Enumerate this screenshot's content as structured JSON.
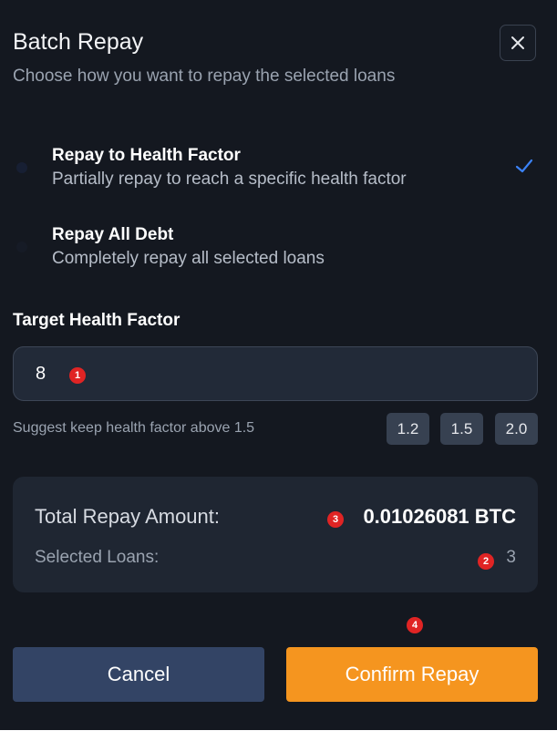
{
  "dialog": {
    "title": "Batch Repay",
    "subtitle": "Choose how you want to repay the selected loans",
    "close_icon": "close-icon"
  },
  "options": [
    {
      "title": "Repay to Health Factor",
      "description": "Partially repay to reach a specific health factor",
      "selected": true
    },
    {
      "title": "Repay All Debt",
      "description": "Completely repay all selected loans",
      "selected": false
    }
  ],
  "health_factor": {
    "label": "Target Health Factor",
    "value": "8",
    "hint": "Suggest keep health factor above 1.5",
    "presets": [
      "1.2",
      "1.5",
      "2.0"
    ]
  },
  "summary": {
    "total_label": "Total Repay Amount:",
    "total_value": "0.01026081 BTC",
    "loans_label": "Selected Loans:",
    "loans_value": "3"
  },
  "markers": [
    "1",
    "2",
    "3",
    "4"
  ],
  "buttons": {
    "cancel": "Cancel",
    "confirm": "Confirm Repay"
  },
  "colors": {
    "background": "#141820",
    "accent": "#f5951f",
    "cancel": "#334465",
    "check": "#3b82f6",
    "marker": "#e02424"
  }
}
